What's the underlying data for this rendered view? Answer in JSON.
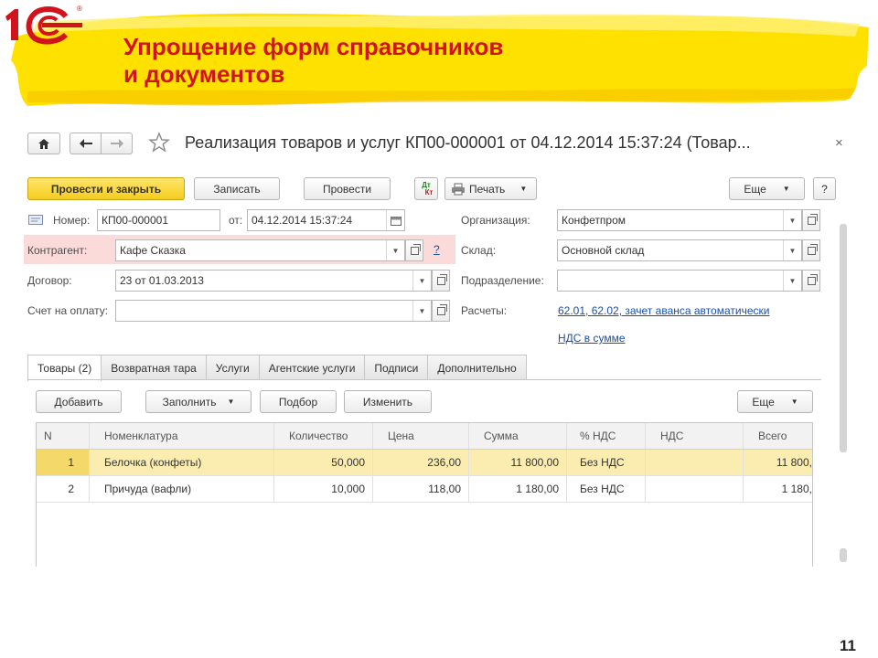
{
  "slide": {
    "title_line1": "Упрощение форм справочников",
    "title_line2": "и документов",
    "page_number": "11"
  },
  "colors": {
    "accent": "#d1131d",
    "banner": "#ffe100",
    "primary_btn": "#f5cc1e",
    "link": "#1a4fa8",
    "selected_row": "#fbedb0"
  },
  "window": {
    "title": "Реализация товаров и услуг КП00-000001 от 04.12.2014 15:37:24 (Товар...",
    "close": "×"
  },
  "toolbar": {
    "post_close": "Провести и закрыть",
    "save": "Записать",
    "post": "Провести",
    "dtkt_top": "Дт",
    "dtkt_bottom": "Кт",
    "print": "Печать",
    "more": "Еще",
    "help": "?"
  },
  "form": {
    "number_label": "Номер:",
    "number_value": "КП00-000001",
    "date_label": "от:",
    "date_value": "04.12.2014 15:37:24",
    "org_label": "Организация:",
    "org_value": "Конфетпром",
    "counterparty_label": "Контрагент:",
    "counterparty_value": "Кафе Сказка",
    "counterparty_help": "?",
    "warehouse_label": "Склад:",
    "warehouse_value": "Основной склад",
    "contract_label": "Договор:",
    "contract_value": "23  от 01.03.2013",
    "department_label": "Подразделение:",
    "department_value": "",
    "invoice_label": "Счет на оплату:",
    "invoice_value": "",
    "settlements_label": "Расчеты:",
    "settlements_link": "62.01, 62.02, зачет аванса автоматически",
    "vat_link": "НДС в сумме"
  },
  "tabs": [
    {
      "label": "Товары (2)",
      "active": true
    },
    {
      "label": "Возвратная тара",
      "active": false
    },
    {
      "label": "Услуги",
      "active": false
    },
    {
      "label": "Агентские услуги",
      "active": false
    },
    {
      "label": "Подписи",
      "active": false
    },
    {
      "label": "Дополнительно",
      "active": false
    }
  ],
  "table_toolbar": {
    "add": "Добавить",
    "fill": "Заполнить",
    "pick": "Подбор",
    "change": "Изменить",
    "more": "Еще"
  },
  "table": {
    "columns": [
      "N",
      "Номенклатура",
      "Количество",
      "Цена",
      "Сумма",
      "% НДС",
      "НДС",
      "Всего"
    ],
    "rows": [
      [
        "1",
        "Белочка (конфеты)",
        "50,000",
        "236,00",
        "11 800,00",
        "Без НДС",
        "",
        "11 800,"
      ],
      [
        "2",
        "Причуда (вафли)",
        "10,000",
        "118,00",
        "1 180,00",
        "Без НДС",
        "",
        "1 180,"
      ]
    ]
  }
}
